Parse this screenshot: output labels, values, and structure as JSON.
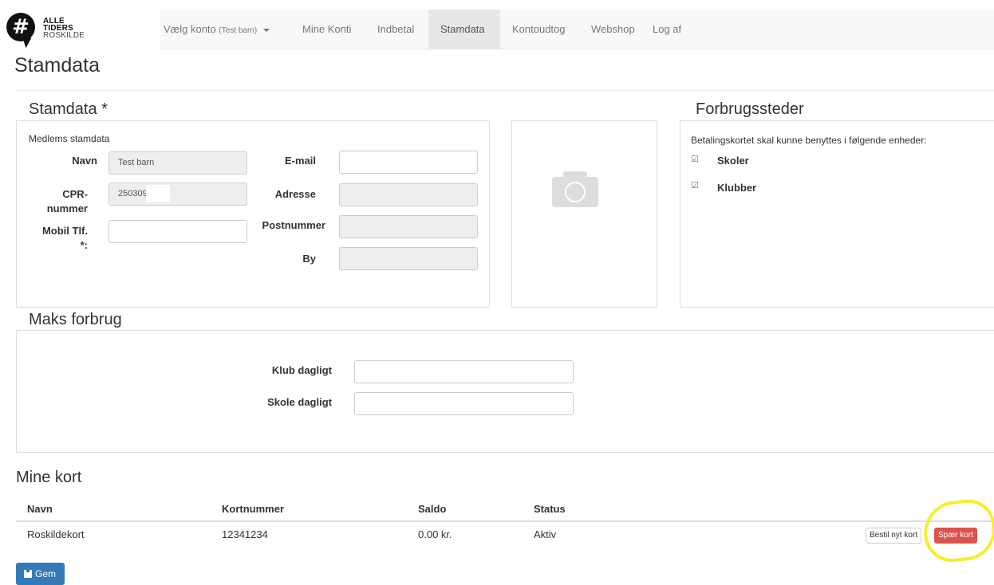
{
  "logo": {
    "glyph": "#",
    "line1": "ALLE",
    "line2": "TIDERS",
    "line3": "ROSKILDE"
  },
  "nav": {
    "account_label": "Vælg konto",
    "account_value": "(Test barn)",
    "items": [
      "Mine Konti",
      "Indbetal",
      "Stamdata",
      "Kontoudtog",
      "Webshop",
      "Log af"
    ],
    "active": "Stamdata"
  },
  "page": {
    "title": "Stamdata"
  },
  "stamdata": {
    "title": "Stamdata *",
    "subheading": "Medlems stamdata",
    "navn": {
      "label": "Navn",
      "value": "Test barn"
    },
    "cpr": {
      "label_line1": "CPR-",
      "label_line2": "nummer",
      "value": "250309"
    },
    "mobil": {
      "label_line1": "Mobil Tlf.",
      "label_line2": "*:",
      "value": ""
    },
    "email": {
      "label": "E-mail",
      "value": ""
    },
    "adresse": {
      "label": "Adresse",
      "value": ""
    },
    "postnummer": {
      "label": "Postnummer",
      "value": ""
    },
    "by": {
      "label": "By",
      "value": ""
    }
  },
  "photo": {
    "icon": "camera-icon"
  },
  "forbrugssteder": {
    "title": "Forbrugssteder",
    "description": "Betalingskortet skal kunne benyttes i følgende enheder:",
    "items": [
      {
        "label": "Skoler",
        "checked": true,
        "mark": "☑"
      },
      {
        "label": "Klubber",
        "checked": true,
        "mark": "☑"
      }
    ]
  },
  "maks_forbrug": {
    "title": "Maks forbrug",
    "klub": {
      "label": "Klub dagligt",
      "value": ""
    },
    "skole": {
      "label": "Skole dagligt",
      "value": ""
    }
  },
  "mine_kort": {
    "title": "Mine kort",
    "columns": [
      "Navn",
      "Kortnummer",
      "Saldo",
      "Status"
    ],
    "rows": [
      {
        "navn": "Roskildekort",
        "kortnummer": "12341234",
        "saldo": "0.00 kr.",
        "status": "Aktiv"
      }
    ],
    "order_button": "Bestil nyt kort",
    "block_button": "Spær kort"
  },
  "save_button": {
    "label": "Gem",
    "icon": "floppy-disk-icon"
  },
  "colors": {
    "primary": "#337ab7",
    "danger": "#d9534f",
    "highlight": "#f6ee2a"
  }
}
